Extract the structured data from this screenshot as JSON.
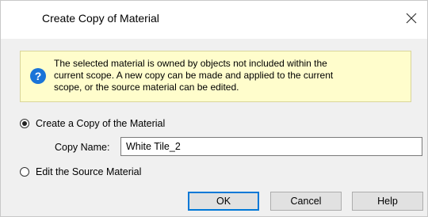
{
  "dialog": {
    "title": "Create Copy of Material",
    "close_glyph": "✕",
    "info": {
      "icon": "question-icon",
      "icon_glyph": "?",
      "message": "The selected material is owned by objects not included within the\ncurrent scope. A new copy can be made and applied to the current\nscope, or the source material can be edited."
    },
    "options": {
      "create_copy_label": "Create a Copy of the Material",
      "create_copy_selected": true,
      "edit_source_label": "Edit the Source Material",
      "edit_source_selected": false
    },
    "copy_name": {
      "label": "Copy Name:",
      "value": "White Tile_2"
    },
    "buttons": {
      "ok": "OK",
      "cancel": "Cancel",
      "help": "Help"
    }
  }
}
